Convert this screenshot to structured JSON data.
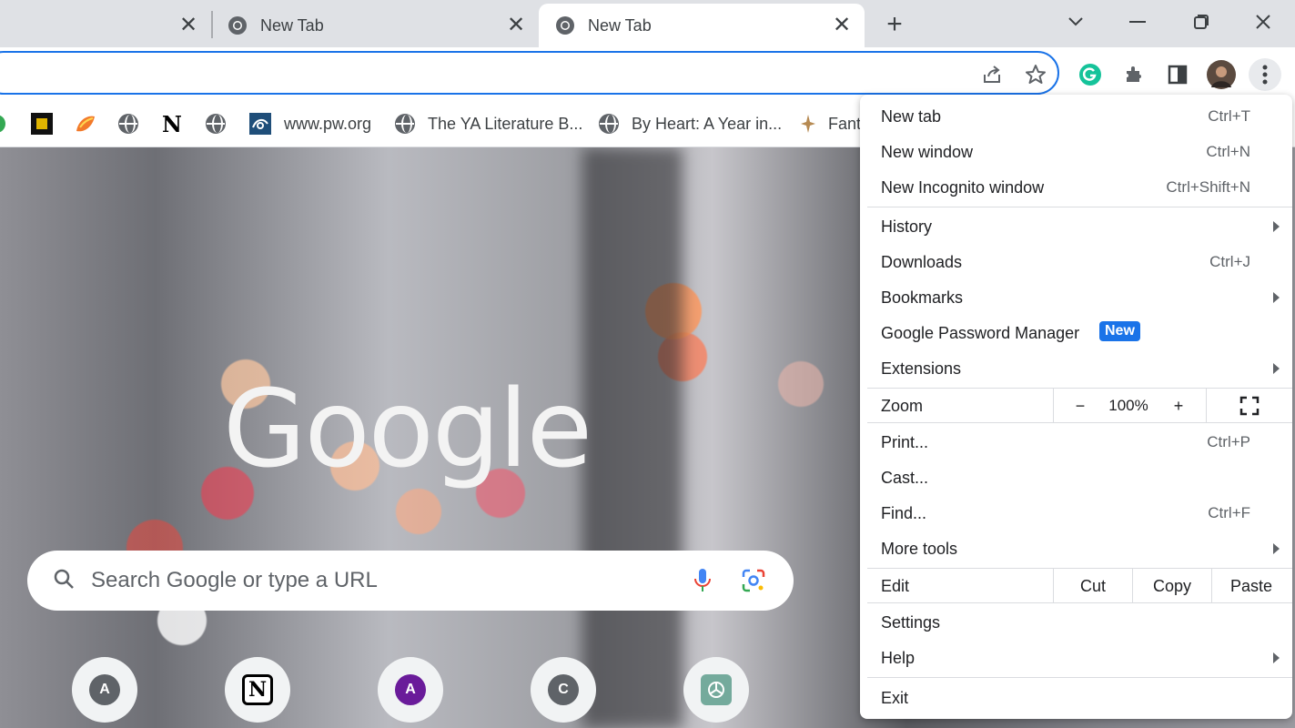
{
  "tabs": [
    {
      "title": "",
      "close": "✕",
      "active": false
    },
    {
      "title": "New Tab",
      "close": "✕",
      "active": false
    },
    {
      "title": "New Tab",
      "close": "✕",
      "active": true
    }
  ],
  "new_tab_symbol": "+",
  "window_controls": {
    "minimize": "—",
    "maximize": "❐",
    "close": "✕",
    "tab_search": "⌄"
  },
  "bookmarks": [
    {
      "label": "www.pw.org"
    },
    {
      "label": "The YA Literature B..."
    },
    {
      "label": "By Heart: A Year in..."
    },
    {
      "label": "Fant"
    }
  ],
  "ntp": {
    "logo": "Google",
    "search_placeholder": "Search Google or type a URL",
    "shortcuts": [
      {
        "letter": "A",
        "color": "#5f6368"
      },
      {
        "letter": "N",
        "color": "#000000"
      },
      {
        "letter": "A",
        "color": "#6a1b9a"
      },
      {
        "letter": "C",
        "color": "#5f6368"
      },
      {
        "letter": "",
        "color": "#74aa9c"
      }
    ]
  },
  "menu": {
    "new_tab": {
      "label": "New tab",
      "shortcut": "Ctrl+T"
    },
    "new_window": {
      "label": "New window",
      "shortcut": "Ctrl+N"
    },
    "incognito": {
      "label": "New Incognito window",
      "shortcut": "Ctrl+Shift+N"
    },
    "history": {
      "label": "History"
    },
    "downloads": {
      "label": "Downloads",
      "shortcut": "Ctrl+J"
    },
    "bookmarks": {
      "label": "Bookmarks"
    },
    "password_manager": {
      "label": "Google Password Manager",
      "badge": "New"
    },
    "extensions": {
      "label": "Extensions"
    },
    "zoom": {
      "label": "Zoom",
      "minus": "−",
      "value": "100%",
      "plus": "+"
    },
    "print": {
      "label": "Print...",
      "shortcut": "Ctrl+P"
    },
    "cast": {
      "label": "Cast..."
    },
    "find": {
      "label": "Find...",
      "shortcut": "Ctrl+F"
    },
    "more_tools": {
      "label": "More tools"
    },
    "edit": {
      "label": "Edit",
      "cut": "Cut",
      "copy": "Copy",
      "paste": "Paste"
    },
    "settings": {
      "label": "Settings"
    },
    "help": {
      "label": "Help"
    },
    "exit": {
      "label": "Exit"
    }
  },
  "colors": {
    "accent": "#1a73e8",
    "grammarly": "#15c39a",
    "tabstrip": "#dfe1e5"
  }
}
